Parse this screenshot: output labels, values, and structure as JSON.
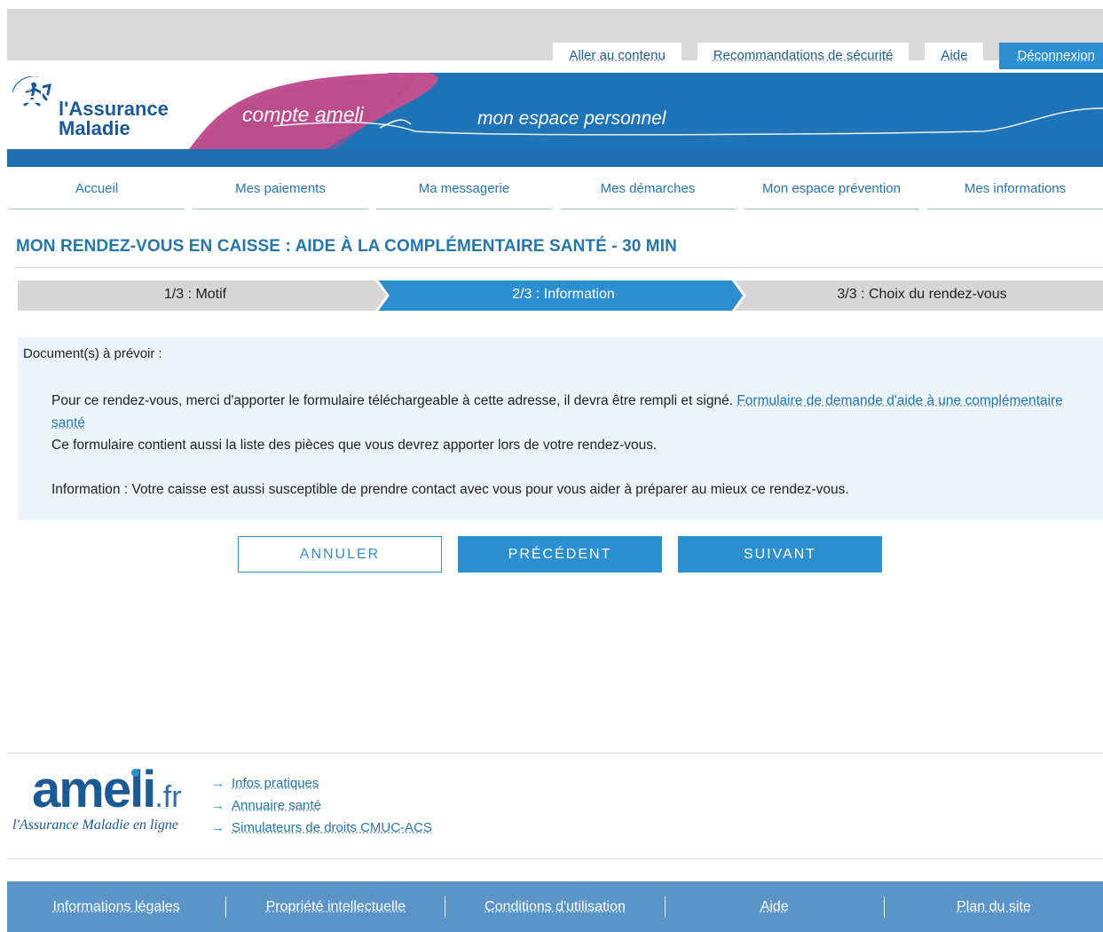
{
  "utility_links": [
    {
      "label": "Aller au contenu"
    },
    {
      "label": "Recommandations de sécurité"
    },
    {
      "label": "Aide"
    },
    {
      "label": "Déconnexion"
    }
  ],
  "banner": {
    "logo_line1": "l'Assurance",
    "logo_line2": "Maladie",
    "compte_ameli": "compte ameli",
    "espace": "mon espace personnel",
    "mail_icon": "email-at-icon",
    "colors": {
      "blue": "#1f73b7",
      "pink": "#c0508f"
    }
  },
  "nav": [
    {
      "label": "Accueil"
    },
    {
      "label": "Mes paiements"
    },
    {
      "label": "Ma messagerie"
    },
    {
      "label": "Mes démarches"
    },
    {
      "label": "Mon espace prévention"
    },
    {
      "label": "Mes informations"
    }
  ],
  "page_title": "MON RENDEZ-VOUS EN CAISSE : AIDE À LA COMPLÉMENTAIRE SANTÉ - 30 MIN",
  "stepper": {
    "steps": [
      {
        "label": "1/3 : Motif",
        "state": "done"
      },
      {
        "label": "2/3 : Information",
        "state": "current"
      },
      {
        "label": "3/3 : Choix du rendez-vous",
        "state": "todo"
      }
    ]
  },
  "info": {
    "heading": "Document(s) à prévoir :",
    "para1": "Pour ce rendez-vous, merci d'apporter le formulaire téléchargeable à cette adresse, il devra être rempli et signé.",
    "form_link": "Formulaire de demande d'aide à une complémentaire santé",
    "para2": "Ce formulaire contient aussi la liste des pièces que vous devrez apporter lors de votre rendez-vous.",
    "para3": "Information : Votre caisse est aussi susceptible de prendre contact avec vous pour vous aider à préparer au mieux ce rendez-vous."
  },
  "buttons": {
    "cancel": "ANNULER",
    "previous": "PRÉCÉDENT",
    "next": "SUIVANT"
  },
  "footer": {
    "logo_main": "ameli",
    "logo_suffix": ".fr",
    "tagline": "l'Assurance Maladie en ligne",
    "links": [
      {
        "label": "Infos pratiques"
      },
      {
        "label": "Annuaire santé"
      },
      {
        "label": "Simulateurs de droits CMUC-ACS"
      }
    ],
    "bottom": [
      {
        "label": "Informations légales"
      },
      {
        "label": "Propriété intellectuelle"
      },
      {
        "label": "Conditions d'utilisation"
      },
      {
        "label": "Aide"
      },
      {
        "label": "Plan du site"
      }
    ],
    "bar_color": "#5b95c8"
  }
}
